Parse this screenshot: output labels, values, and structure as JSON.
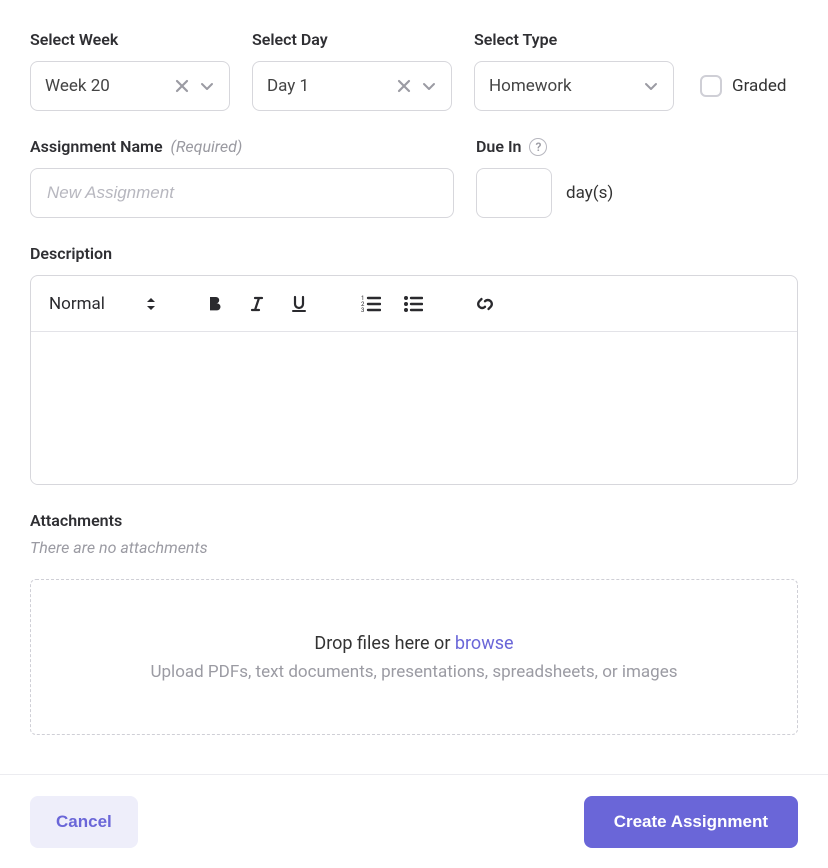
{
  "fields": {
    "week": {
      "label": "Select Week",
      "value": "Week 20"
    },
    "day": {
      "label": "Select Day",
      "value": "Day 1"
    },
    "type": {
      "label": "Select Type",
      "value": "Homework"
    },
    "graded": {
      "label": "Graded",
      "checked": false
    },
    "name": {
      "label": "Assignment Name",
      "required_hint": "(Required)",
      "placeholder": "New Assignment",
      "value": ""
    },
    "due": {
      "label": "Due In",
      "suffix": "day(s)",
      "value": ""
    },
    "description": {
      "label": "Description"
    }
  },
  "editor": {
    "heading_label": "Normal"
  },
  "attachments": {
    "label": "Attachments",
    "empty_text": "There are no attachments",
    "dropzone_text": "Drop files here or ",
    "dropzone_browse": "browse",
    "dropzone_sub": "Upload PDFs, text documents, presentations, spreadsheets, or images"
  },
  "footer": {
    "cancel": "Cancel",
    "submit": "Create Assignment"
  }
}
